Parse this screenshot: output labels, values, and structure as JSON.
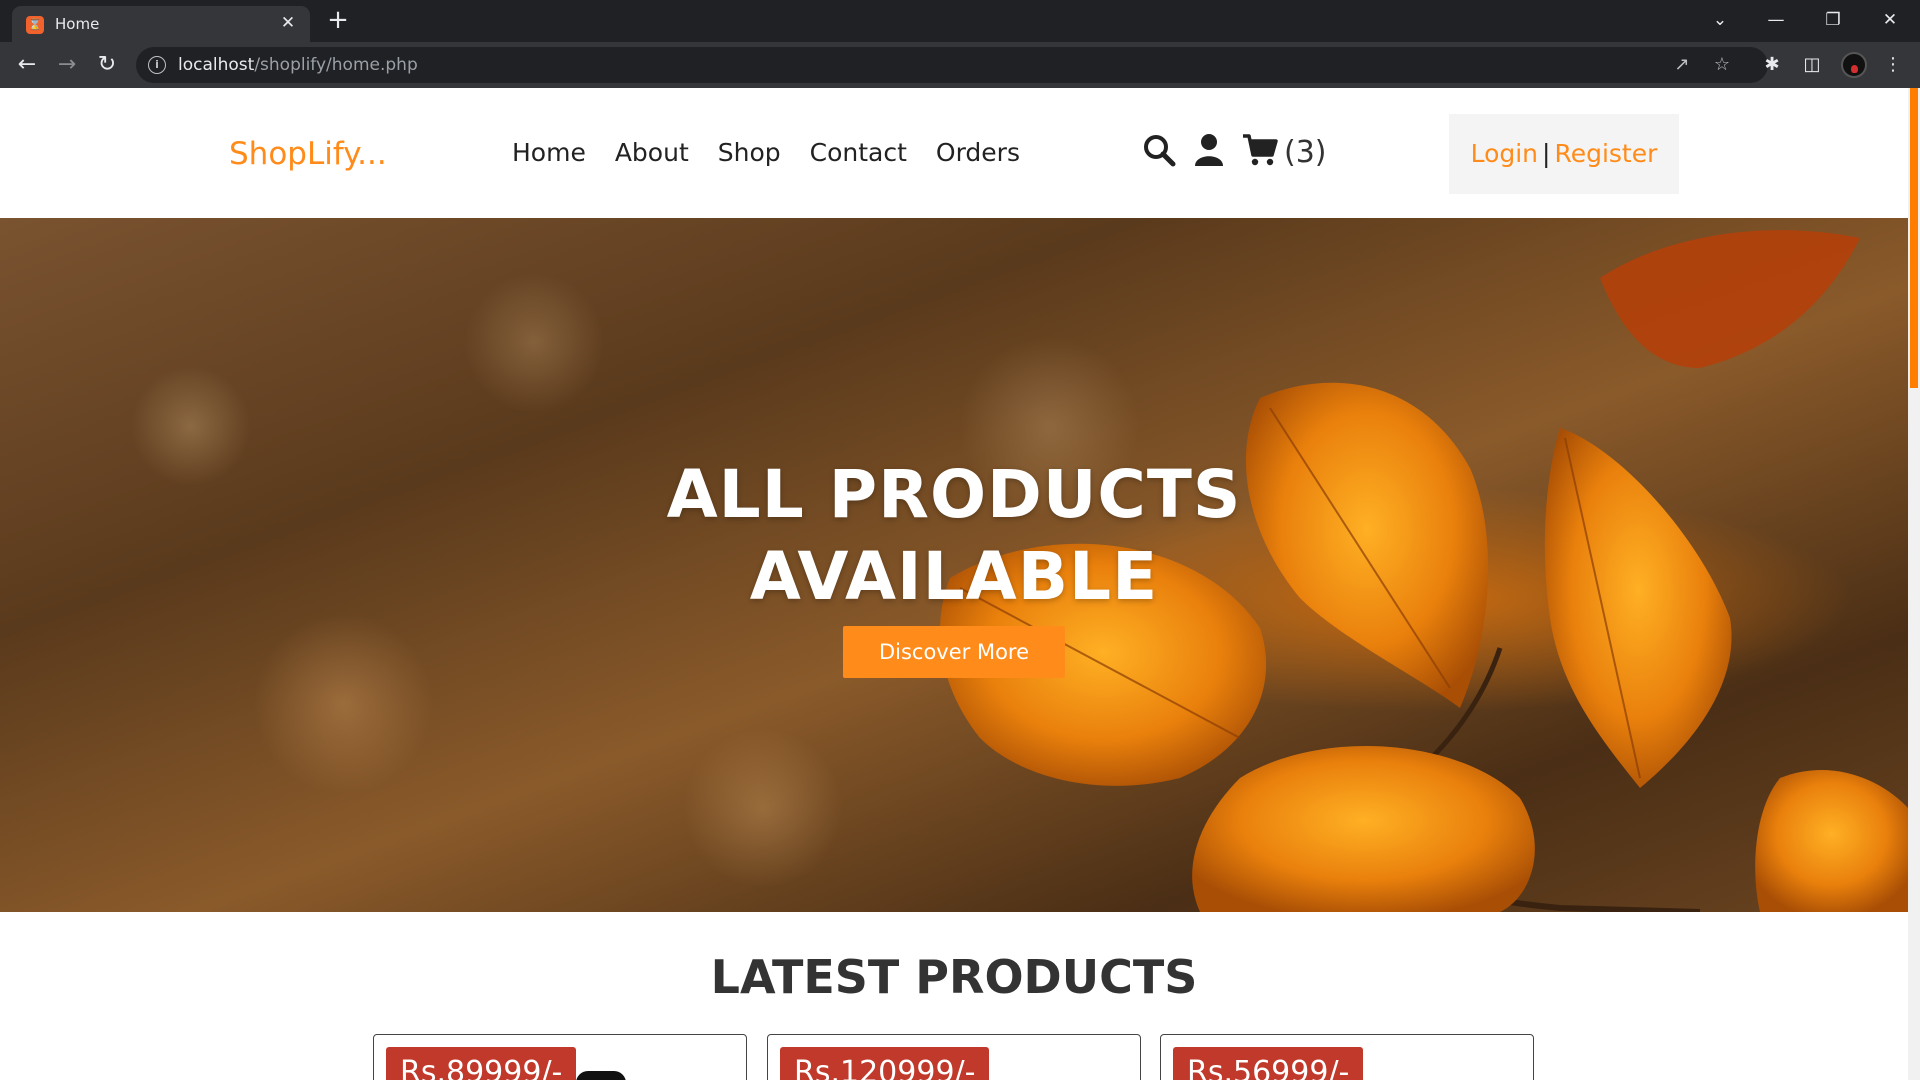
{
  "browser": {
    "tab_title": "Home",
    "url_host": "localhost",
    "url_path": "/shoplify/home.php"
  },
  "header": {
    "logo": "ShopLify...",
    "nav": [
      "Home",
      "About",
      "Shop",
      "Contact",
      "Orders"
    ],
    "cart_count": "(3)",
    "login": "Login",
    "separator": "|",
    "register": "Register"
  },
  "hero": {
    "title_line1": "ALL PRODUCTS",
    "title_line2": "AVAILABLE",
    "button": "Discover More"
  },
  "latest": {
    "title": "LATEST PRODUCTS",
    "prices": [
      "Rs.89999/-",
      "Rs.120999/-",
      "Rs.56999/-"
    ]
  },
  "colors": {
    "accent": "#ff8c1a",
    "price_badge": "#c0392b",
    "chrome_dark": "#202124",
    "chrome_toolbar": "#35363a"
  }
}
